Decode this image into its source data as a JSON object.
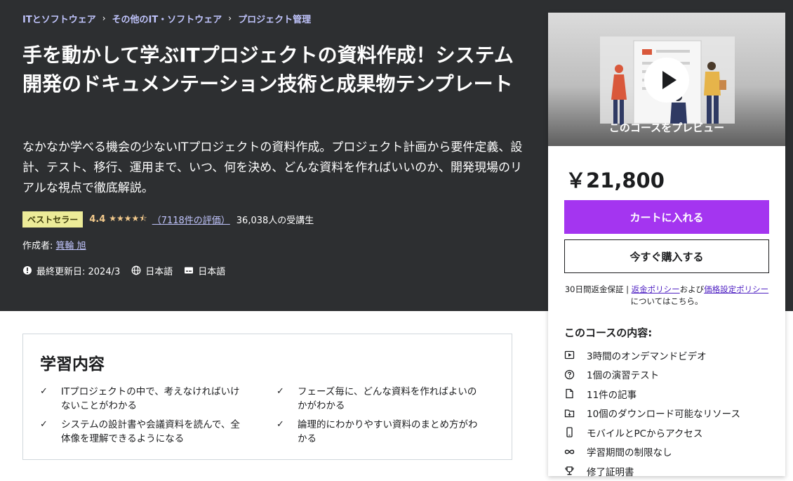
{
  "breadcrumb": [
    "ITとソフトウェア",
    "その他のIT・ソフトウェア",
    "プロジェクト管理"
  ],
  "breadcrumb_sep": "›",
  "course": {
    "title": "手を動かして学ぶITプロジェクトの資料作成！システム開発のドキュメンテーション技術と成果物テンプレート",
    "subtitle": "なかなか学べる機会の少ないITプロジェクトの資料作成。プロジェクト計画から要件定義、設計、テスト、移行、運用まで、いつ、何を決め、どんな資料を作ればいいのか、開発現場のリアルな視点で徹底解説。",
    "badge": "ベストセラー",
    "rating": "4.4",
    "stars": "★★★★⯪",
    "star_rating": 4.4,
    "rating_count": "（7118件の評価）",
    "students": "36,038人の受講生",
    "creator_label": "作成者: ",
    "creator_name": "箕輪 旭",
    "last_updated": "最終更新日: 2024/3",
    "language": "日本語",
    "caption_language": "日本語"
  },
  "sidebar": {
    "preview_label": "このコースをプレビュー",
    "price": "￥21,800",
    "cart_button": "カートに入れる",
    "buy_button": "今すぐ購入する",
    "guarantee_text": "30日間返金保証 | ",
    "refund_policy": "返金ポリシー",
    "and_text": "および",
    "pricing_policy": "価格設定ポリシー",
    "about_text": "についてはこちら。",
    "includes_title": "このコースの内容:",
    "includes": [
      {
        "icon": "video-icon",
        "label": "3時間のオンデマンドビデオ"
      },
      {
        "icon": "quiz-icon",
        "label": "1個の演習テスト"
      },
      {
        "icon": "file-icon",
        "label": "11件の記事"
      },
      {
        "icon": "download-folder-icon",
        "label": "10個のダウンロード可能なリソース"
      },
      {
        "icon": "mobile-icon",
        "label": "モバイルとPCからアクセス"
      },
      {
        "icon": "infinity-icon",
        "label": "学習期間の制限なし"
      },
      {
        "icon": "trophy-icon",
        "label": "修了証明書"
      }
    ]
  },
  "learn": {
    "title": "学習内容",
    "check": "✓",
    "items": [
      "ITプロジェクトの中で、考えなければいけないことがわかる",
      "フェーズ毎に、どんな資料を作ればよいのかがわかる",
      "システムの設計書や会議資料を読んで、全体像を理解できるようになる",
      "論理的にわかりやすい資料のまとめ方がわかる"
    ]
  },
  "colors": {
    "hero_bg": "#2d2f31",
    "accent_purple": "#a435f0",
    "link_purple": "#c0c4fc",
    "star_gold": "#f3ca8c",
    "badge_bg": "#eceb98"
  }
}
